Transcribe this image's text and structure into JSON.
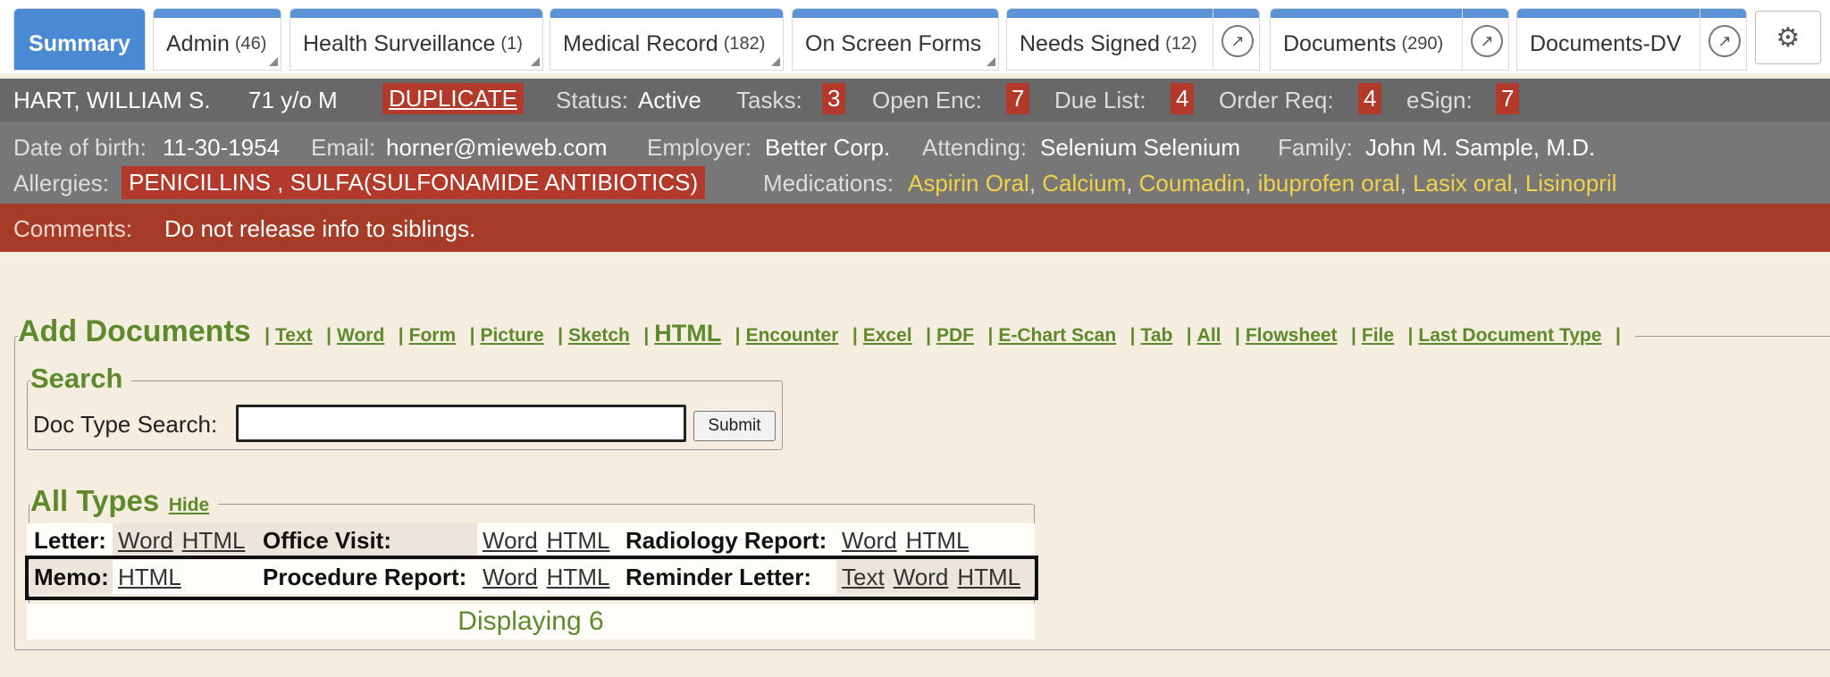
{
  "tabs": [
    {
      "label": "Summary",
      "count": ""
    },
    {
      "label": "Admin",
      "count": "(46)"
    },
    {
      "label": "Health Surveillance",
      "count": "(1)"
    },
    {
      "label": "Medical Record",
      "count": "(182)"
    },
    {
      "label": "On Screen Forms",
      "count": ""
    },
    {
      "label": "Needs Signed",
      "count": "(12)"
    },
    {
      "label": "Documents",
      "count": "(290)"
    },
    {
      "label": "Documents-DV",
      "count": ""
    }
  ],
  "patient": {
    "name": "HART, WILLIAM S.",
    "age_sex": "71 y/o M",
    "duplicate": "DUPLICATE",
    "status_label": "Status:",
    "status": "Active",
    "tasks_label": "Tasks:",
    "tasks": "3",
    "open_enc_label": "Open Enc:",
    "open_enc": "7",
    "due_list_label": "Due List:",
    "due_list": "4",
    "order_req_label": "Order Req:",
    "order_req": "4",
    "esign_label": "eSign:",
    "esign": "7",
    "dob_label": "Date of birth:",
    "dob": "11-30-1954",
    "email_label": "Email:",
    "email": "horner@mieweb.com",
    "employer_label": "Employer:",
    "employer": "Better Corp.",
    "attending_label": "Attending:",
    "attending": "Selenium Selenium",
    "family_label": "Family:",
    "family": "John M. Sample, M.D.",
    "allergies_label": "Allergies:",
    "allergies": "PENICILLINS , SULFA(SULFONAMIDE ANTIBIOTICS)",
    "medications_label": "Medications:",
    "medications": [
      "Aspirin Oral",
      "Calcium",
      "Coumadin",
      "ibuprofen oral",
      "Lasix oral",
      "Lisinopril"
    ],
    "comments_label": "Comments:",
    "comments": "Do not release info to siblings."
  },
  "add_documents": {
    "title": "Add Documents",
    "links": [
      "Text",
      "Word",
      "Form",
      "Picture",
      "Sketch",
      "HTML",
      "Encounter",
      "Excel",
      "PDF",
      "E-Chart Scan",
      "Tab",
      "All",
      "Flowsheet",
      "File",
      "Last Document Type"
    ]
  },
  "search": {
    "title": "Search",
    "label": "Doc Type Search:",
    "value": "",
    "submit": "Submit"
  },
  "all_types": {
    "title": "All Types",
    "hide": "Hide",
    "rows": [
      [
        {
          "label": "Letter",
          "links": [
            "Word",
            "HTML"
          ]
        },
        {
          "label": "Office Visit",
          "links": [
            "Word",
            "HTML"
          ]
        },
        {
          "label": "Radiology Report",
          "links": [
            "Word",
            "HTML"
          ]
        }
      ],
      [
        {
          "label": "Memo",
          "links": [
            "HTML"
          ]
        },
        {
          "label": "Procedure Report",
          "links": [
            "Word",
            "HTML"
          ]
        },
        {
          "label": "Reminder Letter",
          "links": [
            "Text",
            "Word",
            "HTML"
          ]
        }
      ]
    ],
    "footer": "Displaying 6"
  },
  "colors": {
    "accent": "#4a8ad4",
    "alert": "#b33a2a",
    "green": "#5e8a2c",
    "med": "#f2d248"
  }
}
